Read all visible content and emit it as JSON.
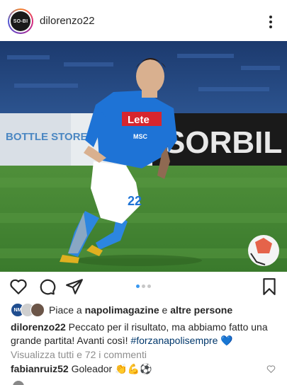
{
  "post": {
    "username": "dilorenzo22",
    "avatar_text": "SO-BI",
    "more_icon": "more-vertical-icon"
  },
  "photo": {
    "banner_left": "BOTTLE STORE",
    "banner_right": "SORBIL",
    "jersey_sponsor": "Lete",
    "jersey_sub": "MSC",
    "jersey_number": "22",
    "colors": {
      "pitch": "#3f7d30",
      "jersey": "#1e73d6",
      "stands": "#1f3f78"
    }
  },
  "actions": {
    "like_icon": "heart-icon",
    "comment_icon": "comment-icon",
    "share_icon": "send-icon",
    "save_icon": "bookmark-icon",
    "carousel_count": 3,
    "carousel_active": 1
  },
  "likes": {
    "prefix": "Piace a ",
    "user": "napolimagazine",
    "middle": " e ",
    "others": "altre persone",
    "avatar_labels": [
      "NM",
      "",
      ""
    ]
  },
  "caption": {
    "user": "dilorenzo22",
    "text": " Peccato per il risultato, ma abbiamo fatto una grande partita! Avanti così! ",
    "hashtag": "#forzanapolisempre",
    "emoji": " 💙"
  },
  "comments": {
    "view_all": "Visualizza tutti e 72 i commenti",
    "first_user": "fabianruiz52",
    "first_text": " Goleador 👏💪⚽"
  }
}
